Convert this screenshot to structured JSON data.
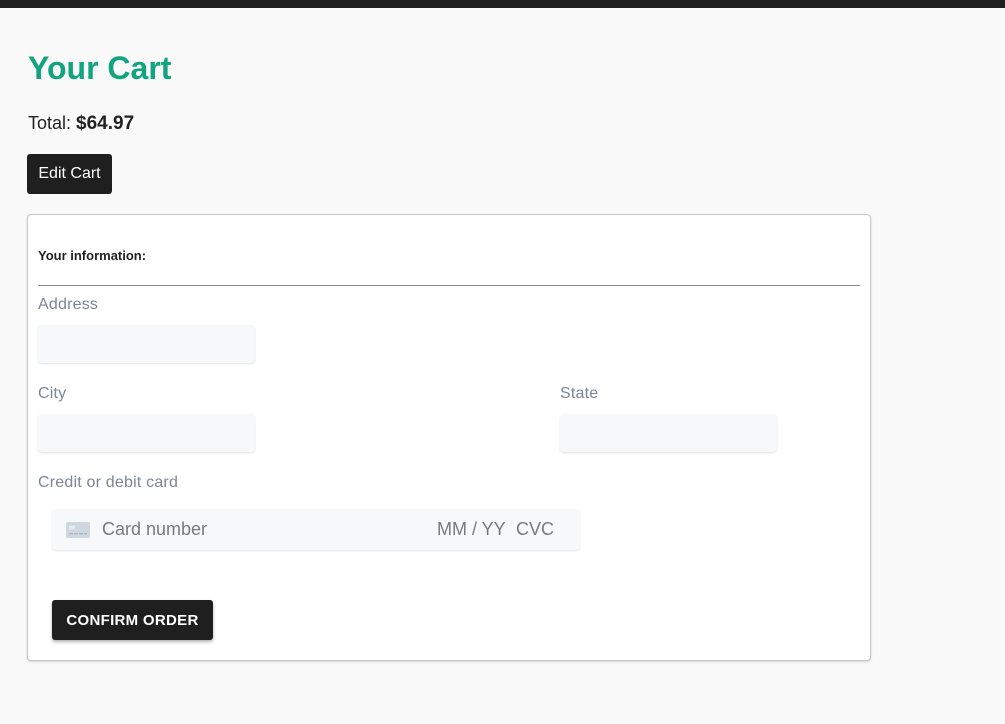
{
  "cart": {
    "title": "Your Cart",
    "total_label": "Total:",
    "total_amount": "$64.97",
    "edit_label": "Edit Cart"
  },
  "checkout": {
    "heading": "Your information:",
    "address_label": "Address",
    "address_value": "",
    "city_label": "City",
    "city_value": "",
    "state_label": "State",
    "state_value": "",
    "card_label": "Credit or debit card",
    "card_number_placeholder": "Card number",
    "card_exp_placeholder": "MM / YY",
    "card_cvc_placeholder": "CVC",
    "card_icon": "credit-card-icon",
    "confirm_label": "CONFIRM ORDER"
  },
  "colors": {
    "accent": "#12a37f",
    "button_bg": "#1f1f1f",
    "input_bg": "#f6f8fa",
    "label_color": "#7a8796"
  }
}
